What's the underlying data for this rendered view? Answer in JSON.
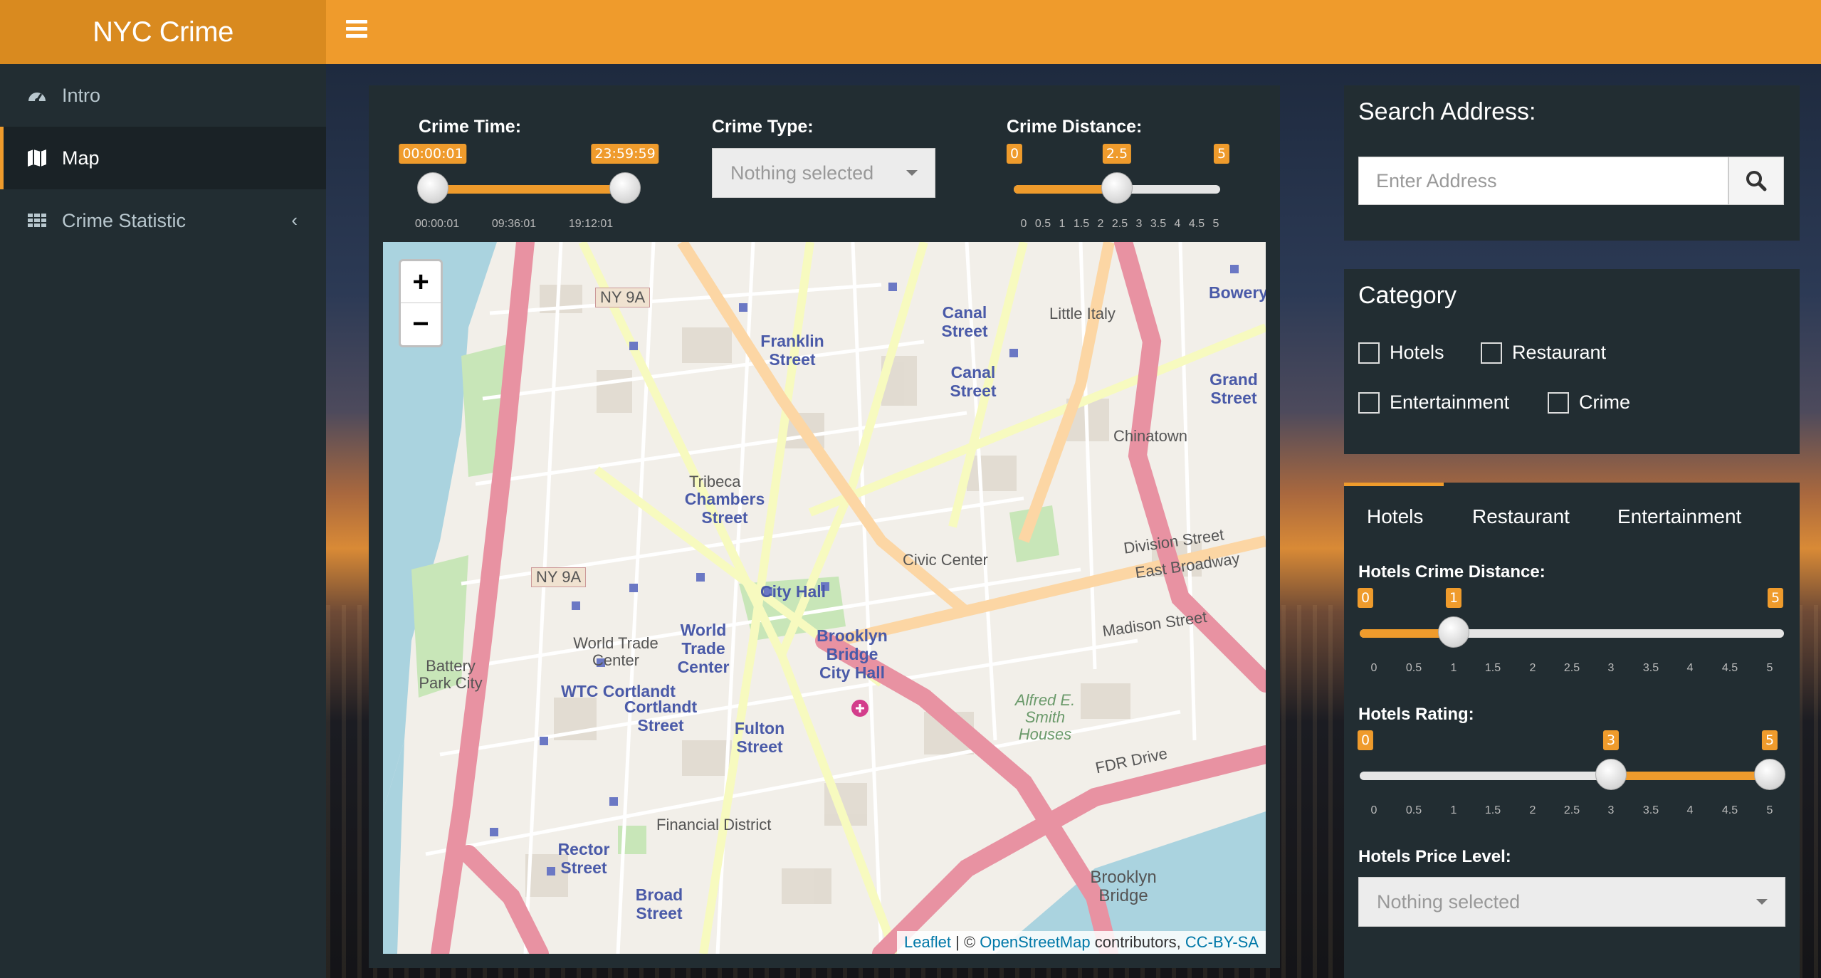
{
  "app": {
    "title": "NYC Crime"
  },
  "sidebar": {
    "items": [
      {
        "label": "Intro",
        "icon": "dashboard-icon"
      },
      {
        "label": "Map",
        "icon": "map-icon"
      },
      {
        "label": "Crime Statistic",
        "icon": "grid-icon",
        "chevron": "‹"
      }
    ]
  },
  "filters": {
    "time": {
      "label": "Crime Time:",
      "min_tag": "00:00:01",
      "max_tag": "23:59:59",
      "range": [
        0,
        1
      ],
      "ticks": [
        "00:00:01",
        "09:36:01",
        "19:12:01"
      ]
    },
    "type": {
      "label": "Crime Type:",
      "placeholder": "Nothing selected"
    },
    "distance": {
      "label": "Crime Distance:",
      "min_tag": "0",
      "value_tag": "2.5",
      "max_tag": "5",
      "value": 2.5,
      "min": 0,
      "max": 5,
      "ticks": [
        "0",
        "0.5",
        "1",
        "1.5",
        "2",
        "2.5",
        "3",
        "3.5",
        "4",
        "4.5",
        "5"
      ]
    }
  },
  "map": {
    "zoom_in": "+",
    "zoom_out": "−",
    "attribution": {
      "leaflet": "Leaflet",
      "sep": " | © ",
      "osm": "OpenStreetMap",
      "contrib": " contributors, ",
      "license": "CC-BY-SA"
    },
    "labels": {
      "ny9a_top": "NY 9A",
      "ny9a_mid": "NY 9A",
      "franklin": "Franklin Street",
      "canal1": "Canal Street",
      "canal2": "Canal Street",
      "grand": "Grand Street",
      "bowery": "Bowery",
      "chambers": "Chambers Street",
      "tribeca": "Tribeca",
      "cityhall": "City Hall",
      "civic": "Civic Center",
      "wtc": "World Trade Center",
      "wtc_street": "World Trade Center",
      "wtccortlandt": "WTC Cortlandt",
      "cortlandt": "Cortlandt Street",
      "fulton": "Fulton Street",
      "brooklynbridge": "Brooklyn Bridge City Hall",
      "battery": "Battery Park City",
      "financial": "Financial District",
      "rector": "Rector Street",
      "broad": "Broad Street",
      "chinatown": "Chinatown",
      "littleitaly": "Little Italy",
      "madison": "Madison Street",
      "division": "Division Street",
      "eastbroadway": "East Broadway",
      "smith": "Alfred E. Smith Houses",
      "bridge": "Brooklyn Bridge",
      "fdr": "FDR Drive"
    }
  },
  "search": {
    "title": "Search Address:",
    "placeholder": "Enter Address",
    "icon": "search-icon"
  },
  "category": {
    "title": "Category",
    "options": [
      {
        "label": "Hotels",
        "checked": false
      },
      {
        "label": "Restaurant",
        "checked": false
      },
      {
        "label": "Entertainment",
        "checked": false
      },
      {
        "label": "Crime",
        "checked": false
      }
    ]
  },
  "tabs": {
    "items": [
      "Hotels",
      "Restaurant",
      "Entertainment"
    ],
    "active": 0
  },
  "hotels": {
    "distance": {
      "label": "Hotels Crime Distance:",
      "min_tag": "0",
      "value_tag": "1",
      "max_tag": "5",
      "value": 1,
      "min": 0,
      "max": 5
    },
    "rating": {
      "label": "Hotels Rating:",
      "min_tag": "0",
      "from_tag": "3",
      "to_tag": "5",
      "from": 3,
      "to": 5,
      "min": 0,
      "max": 5
    },
    "ticks": [
      "0",
      "0.5",
      "1",
      "1.5",
      "2",
      "2.5",
      "3",
      "3.5",
      "4",
      "4.5",
      "5"
    ],
    "price": {
      "label": "Hotels Price Level:",
      "placeholder": "Nothing selected"
    }
  },
  "colors": {
    "accent": "#ef9b2c",
    "logo": "#d98a1f",
    "sidebar": "#222d32",
    "water": "#aad3df",
    "major_road": "#e892a2",
    "road": "#fcd6a4"
  }
}
